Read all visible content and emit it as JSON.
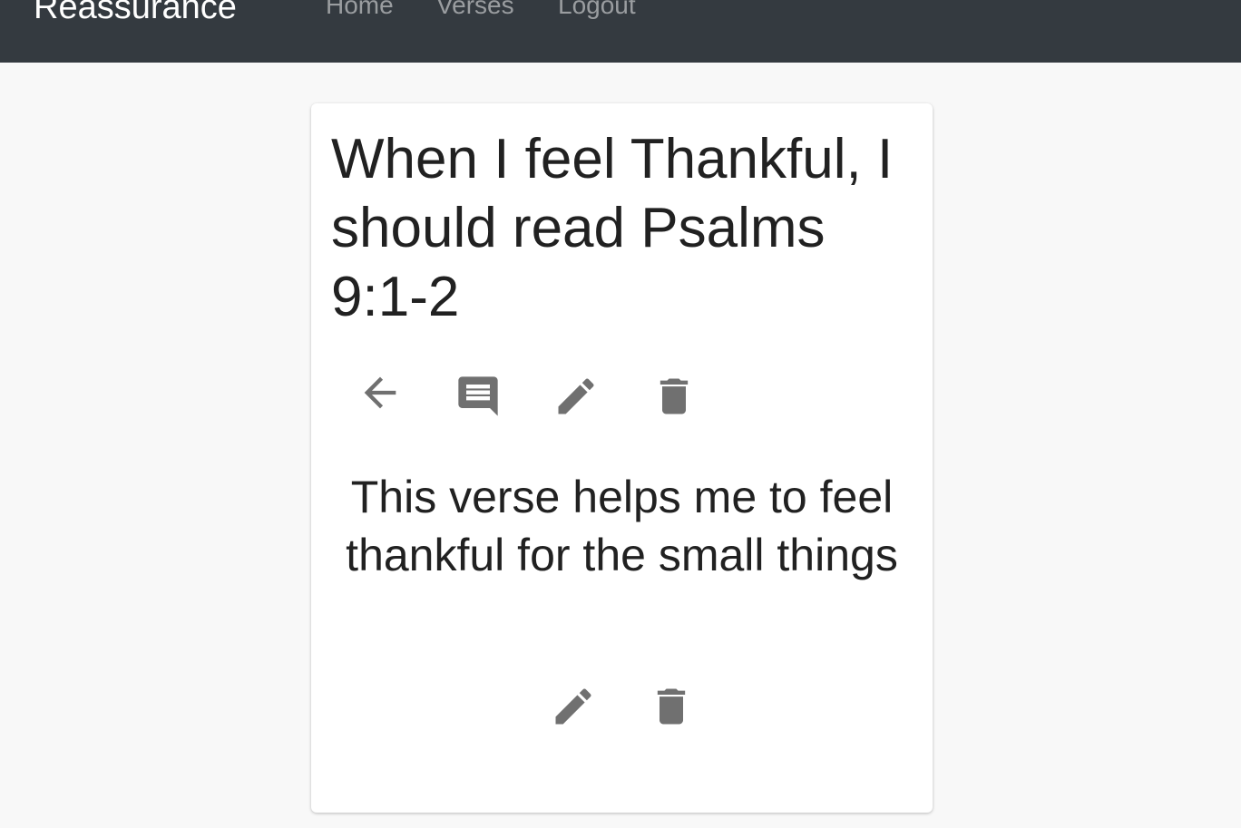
{
  "navbar": {
    "brand": "Reassurance",
    "links": [
      "Home",
      "Verses",
      "Logout"
    ]
  },
  "verse_card": {
    "title": "When I feel Thankful, I should read Psalms 9:1-2",
    "actions": [
      {
        "icon": "arrow-back-icon"
      },
      {
        "icon": "comment-icon"
      },
      {
        "icon": "edit-pencil-icon"
      },
      {
        "icon": "trash-icon"
      }
    ],
    "note": {
      "text": "This verse helps me to feel thankful for the small things",
      "actions": [
        {
          "icon": "edit-pencil-icon"
        },
        {
          "icon": "trash-icon"
        }
      ]
    }
  },
  "colors": {
    "navbar_bg": "#343a40",
    "nav_link": "#9a9da0",
    "brand": "#ffffff",
    "icon": "#707070",
    "page_bg": "#f8f8f8",
    "text": "#212121"
  }
}
